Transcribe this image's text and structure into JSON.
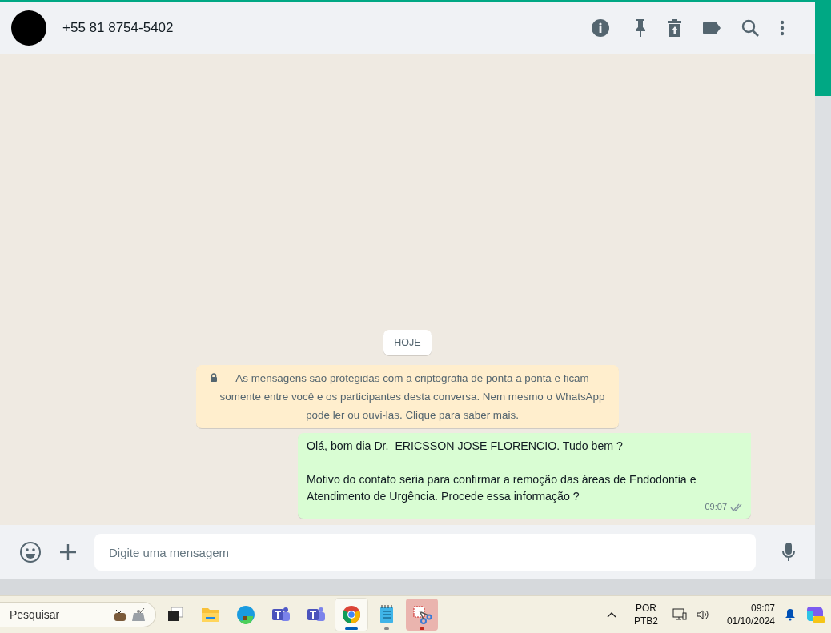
{
  "chat_header": {
    "contact": "+55 81 8754-5402"
  },
  "date_chip": "HOJE",
  "encryption_notice": "As mensagens são protegidas com a criptografia de ponta a ponta e ficam somente entre você e os participantes desta conversa. Nem mesmo o WhatsApp pode ler ou ouvi-las. Clique para saber mais.",
  "messages": [
    {
      "outgoing": true,
      "paragraphs": [
        "Olá, bom dia Dr.  ERICSSON JOSE FLORENCIO. Tudo bem ?",
        "Motivo do contato seria para confirmar a remoção das áreas de Endodontia e Atendimento de Urgência. Procede essa informação ?"
      ],
      "time": "09:07",
      "read": false
    }
  ],
  "composer": {
    "placeholder": "Digite uma mensagem"
  },
  "taskbar": {
    "search": {
      "placeholder": "Pesquisar"
    },
    "apps": [
      {
        "kind": "taskview",
        "selected": false,
        "running": false,
        "attention": false
      },
      {
        "kind": "folder",
        "selected": false,
        "running": false,
        "attention": false
      },
      {
        "kind": "edge",
        "selected": false,
        "running": false,
        "attention": false
      },
      {
        "kind": "teams-work",
        "selected": false,
        "running": false,
        "attention": false
      },
      {
        "kind": "teams",
        "selected": false,
        "running": false,
        "attention": false
      },
      {
        "kind": "chrome",
        "selected": true,
        "running": true,
        "attention": false
      },
      {
        "kind": "notepad",
        "selected": false,
        "running": true,
        "attention": false
      },
      {
        "kind": "snip",
        "selected": false,
        "running": true,
        "attention": true
      }
    ],
    "language": [
      "POR",
      "PTB2"
    ],
    "time": "09:07",
    "date": "01/10/2024"
  }
}
